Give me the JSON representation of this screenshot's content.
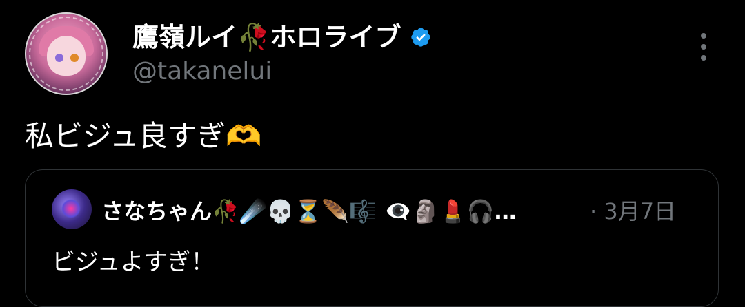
{
  "post": {
    "author": {
      "display_name": "鷹嶺ルイ🥀ホロライブ",
      "handle": "@takanelui",
      "avatar_icon": "user-avatar",
      "verified_icon": "verified-badge-icon",
      "verified_color": "#1d9bf0"
    },
    "text": "私ビジュ良すぎ🫶",
    "more_icon": "more-options-vertical-icon"
  },
  "quote": {
    "author": {
      "display_name": "さなちゃん🥀☄️💀⏳🪶🎼 👁️‍🗨️🗿💄🎧…",
      "avatar_icon": "user-avatar"
    },
    "meta": "· 3月7日",
    "text": "ビジュよすぎ！"
  },
  "colors": {
    "background": "#000000",
    "primary_text": "#ffffff",
    "secondary_text": "#71767b",
    "border": "#2f3336"
  }
}
